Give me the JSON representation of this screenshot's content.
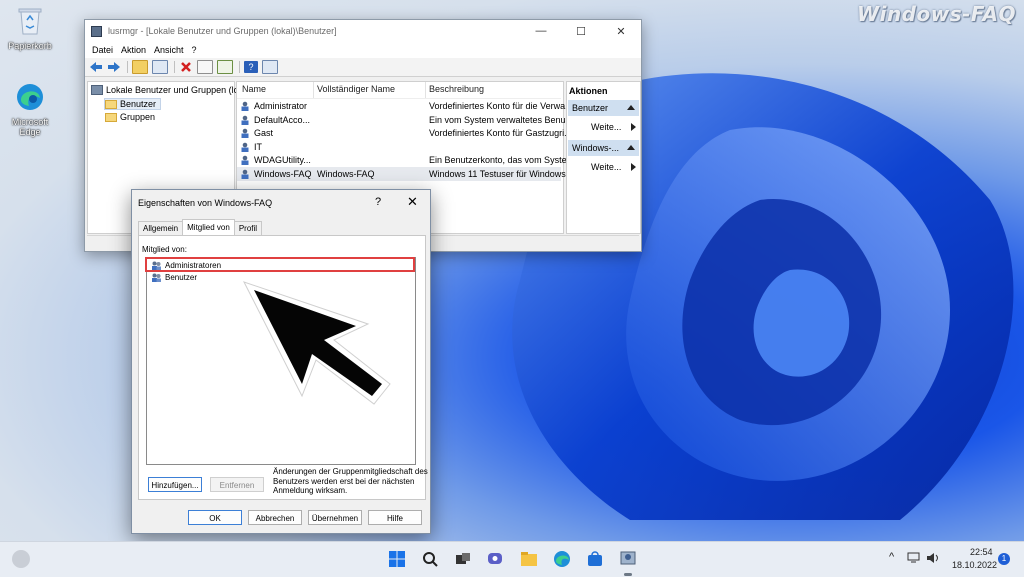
{
  "watermark": "Windows-FAQ",
  "desktop": {
    "icons": [
      {
        "label": "Papierkorb",
        "icon": "recycle-bin-icon"
      },
      {
        "label": "Microsoft Edge",
        "icon": "edge-icon"
      }
    ]
  },
  "mmc": {
    "title": "lusrmgr - [Lokale Benutzer und Gruppen (lokal)\\Benutzer]",
    "window_controls": {
      "minimize": "—",
      "maximize": "☐",
      "close": "✕"
    },
    "menu": [
      "Datei",
      "Aktion",
      "Ansicht",
      "?"
    ],
    "tree": {
      "root": "Lokale Benutzer und Gruppen (lo",
      "children": [
        "Benutzer",
        "Gruppen"
      ],
      "selected": "Benutzer"
    },
    "list": {
      "columns": [
        "Name",
        "Vollständiger Name",
        "Beschreibung"
      ],
      "rows": [
        {
          "name": "Administrator",
          "full_name": "",
          "description": "Vordefiniertes Konto für die Verwa..."
        },
        {
          "name": "DefaultAcco...",
          "full_name": "",
          "description": "Ein vom System verwaltetes Benu..."
        },
        {
          "name": "Gast",
          "full_name": "",
          "description": "Vordefiniertes Konto für Gastzugri..."
        },
        {
          "name": "IT",
          "full_name": "",
          "description": ""
        },
        {
          "name": "WDAGUtility...",
          "full_name": "",
          "description": "Ein Benutzerkonto, das vom Syste..."
        },
        {
          "name": "Windows-FAQ",
          "full_name": "Windows-FAQ",
          "description": "Windows 11 Testuser für Windows"
        }
      ]
    },
    "actions": {
      "header": "Aktionen",
      "sections": [
        {
          "title": "Benutzer",
          "item": "Weite..."
        },
        {
          "title": "Windows-...",
          "item": "Weite..."
        }
      ]
    }
  },
  "dialog": {
    "title": "Eigenschaften von Windows-FAQ",
    "help": "?",
    "close": "✕",
    "tabs": [
      "Allgemein",
      "Mitglied von",
      "Profil"
    ],
    "active_tab": "Mitglied von",
    "member_of_label": "Mitglied von:",
    "groups": [
      "Administratoren",
      "Benutzer"
    ],
    "highlighted_group": "Administratoren",
    "add_button": "Hinzufügen...",
    "remove_button": "Entfernen",
    "note": "Änderungen der Gruppenmitgliedschaft des Benutzers werden erst bei der nächsten Anmeldung wirksam.",
    "buttons": {
      "ok": "OK",
      "cancel": "Abbrechen",
      "apply": "Übernehmen",
      "help": "Hilfe"
    }
  },
  "taskbar": {
    "icons": [
      "weather-icon",
      "start-icon",
      "search-icon",
      "task-view-icon",
      "chat-icon",
      "explorer-icon",
      "edge-icon",
      "store-icon",
      "lusrmgr-icon"
    ],
    "tray": {
      "chevron": "^",
      "time": "22:54",
      "date": "18.10.2022",
      "notifications": "1"
    }
  }
}
